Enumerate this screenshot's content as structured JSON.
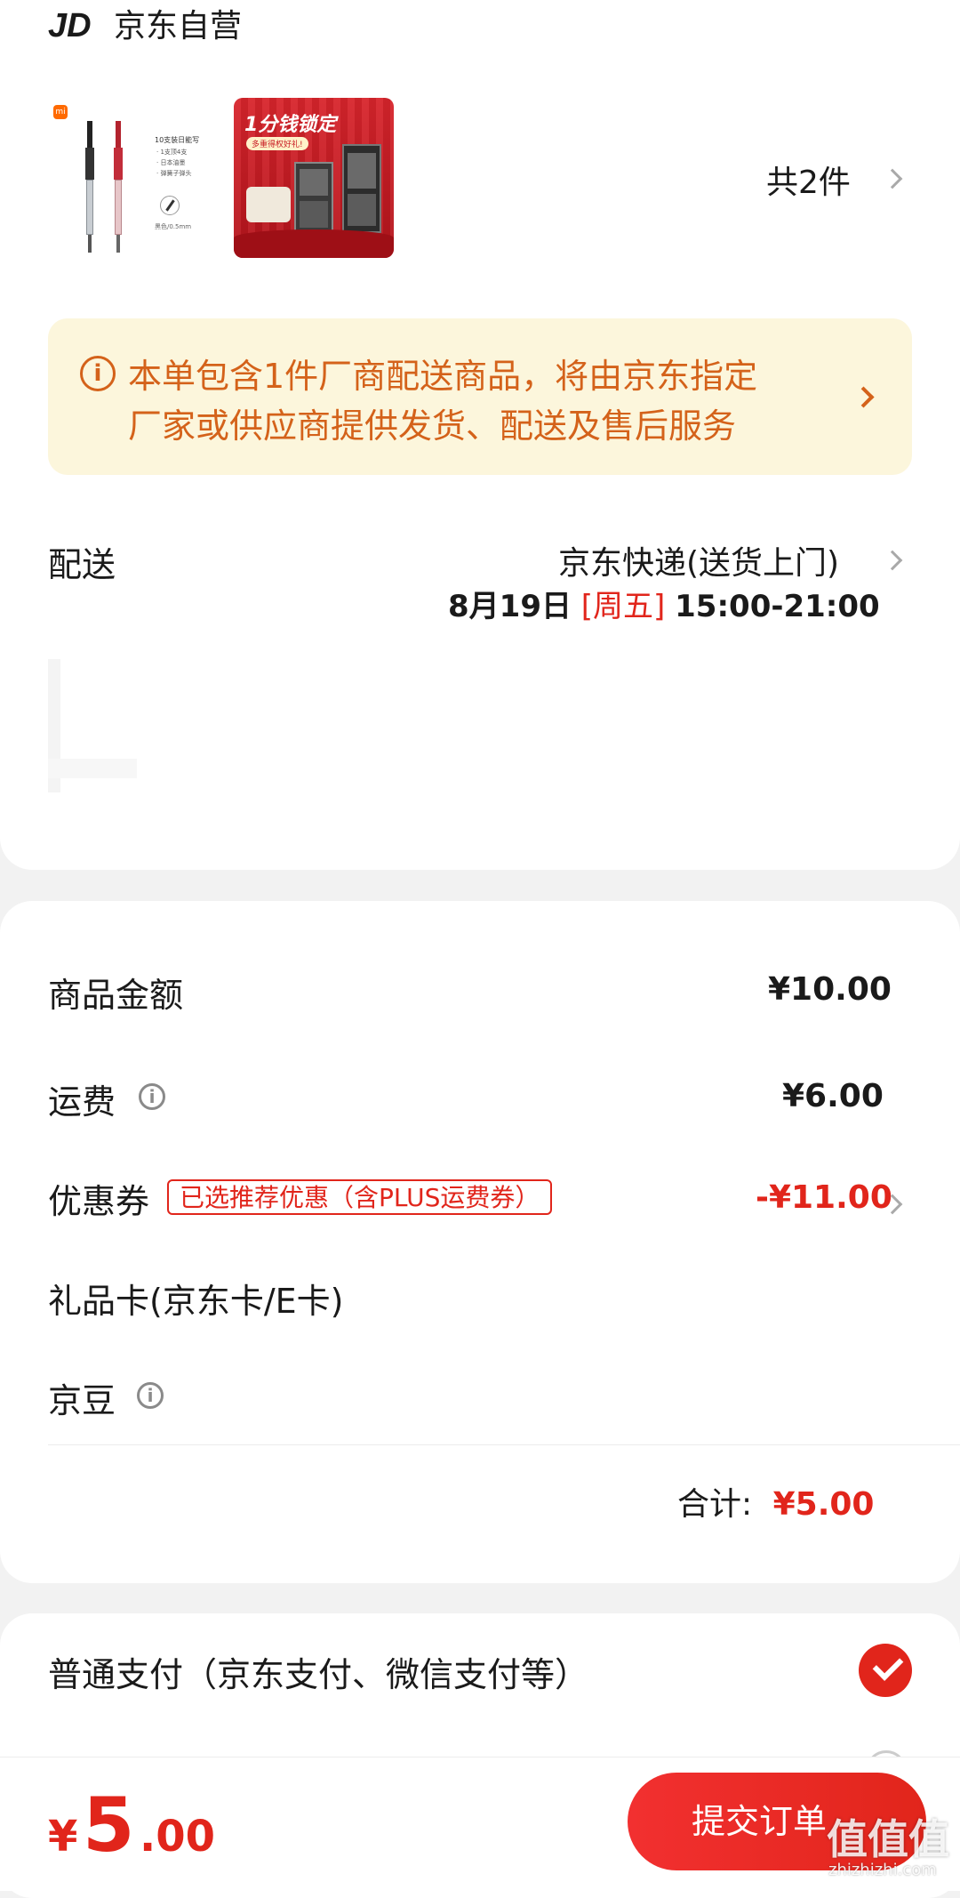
{
  "store": {
    "logo": "JD",
    "name": "京东自营"
  },
  "products": {
    "count_label": "共2件",
    "item1": {
      "badge": "mi",
      "features": [
        "10支装日能写",
        "· 1支顶4支",
        "· 日本油墨",
        "· 弹簧子弹头"
      ],
      "color_note": "黑色/0.5mm"
    },
    "item2": {
      "headline": "1分钱锁定",
      "subline": "多重得权好礼!"
    }
  },
  "notice": {
    "line1": "本单包含1件厂商配送商品，将由京东指定",
    "line2": "厂家或供应商提供发货、配送及售后服务"
  },
  "delivery": {
    "label": "配送",
    "method": "京东快递(送货上门)",
    "date": "8月19日",
    "weekday": "[周五]",
    "time": "15:00-21:00"
  },
  "summary": {
    "goods_label": "商品金额",
    "goods_value": "¥10.00",
    "shipping_label": "运费",
    "shipping_value": "¥6.00",
    "coupon_label": "优惠券",
    "coupon_tag": "已选推荐优惠（含PLUS运费券）",
    "coupon_value": "-¥11.00",
    "giftcard_label": "礼品卡(京东卡/E卡)",
    "jingdou_label": "京豆",
    "total_label": "合计:",
    "total_value": "¥5.00"
  },
  "payment": {
    "option_label": "普通支付（京东支付、微信支付等）"
  },
  "footer": {
    "currency": "¥",
    "price_int": "5",
    "price_dec": ".00",
    "submit_label": "提交订单",
    "watermark": "值值值",
    "watermark_url": "zhizhizhi.com"
  },
  "colors": {
    "accent": "#e1251b",
    "notice_bg": "#fcf6dc",
    "notice_text": "#d4621a",
    "background": "#f2f2f2"
  }
}
